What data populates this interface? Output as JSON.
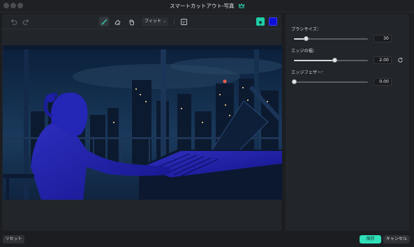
{
  "window": {
    "title": "スマートカットアウト-写真"
  },
  "toolbar": {
    "fit_label": "フィット"
  },
  "params": [
    {
      "label": "ブラシサイズ：",
      "value": "30",
      "fraction": 0.16
    },
    {
      "label": "エッジの幅：",
      "value": "2.00",
      "fraction": 0.55
    },
    {
      "label": "エッジフェザー：",
      "value": "0.00",
      "fraction": 0.0
    }
  ],
  "footer": {
    "reset_label": "リセット",
    "save_label": "保存",
    "cancel_label": "キャンセル"
  },
  "colors": {
    "accent": "#2fe0b8",
    "overlay": "#0d0fd6",
    "panel": "#22252a"
  }
}
